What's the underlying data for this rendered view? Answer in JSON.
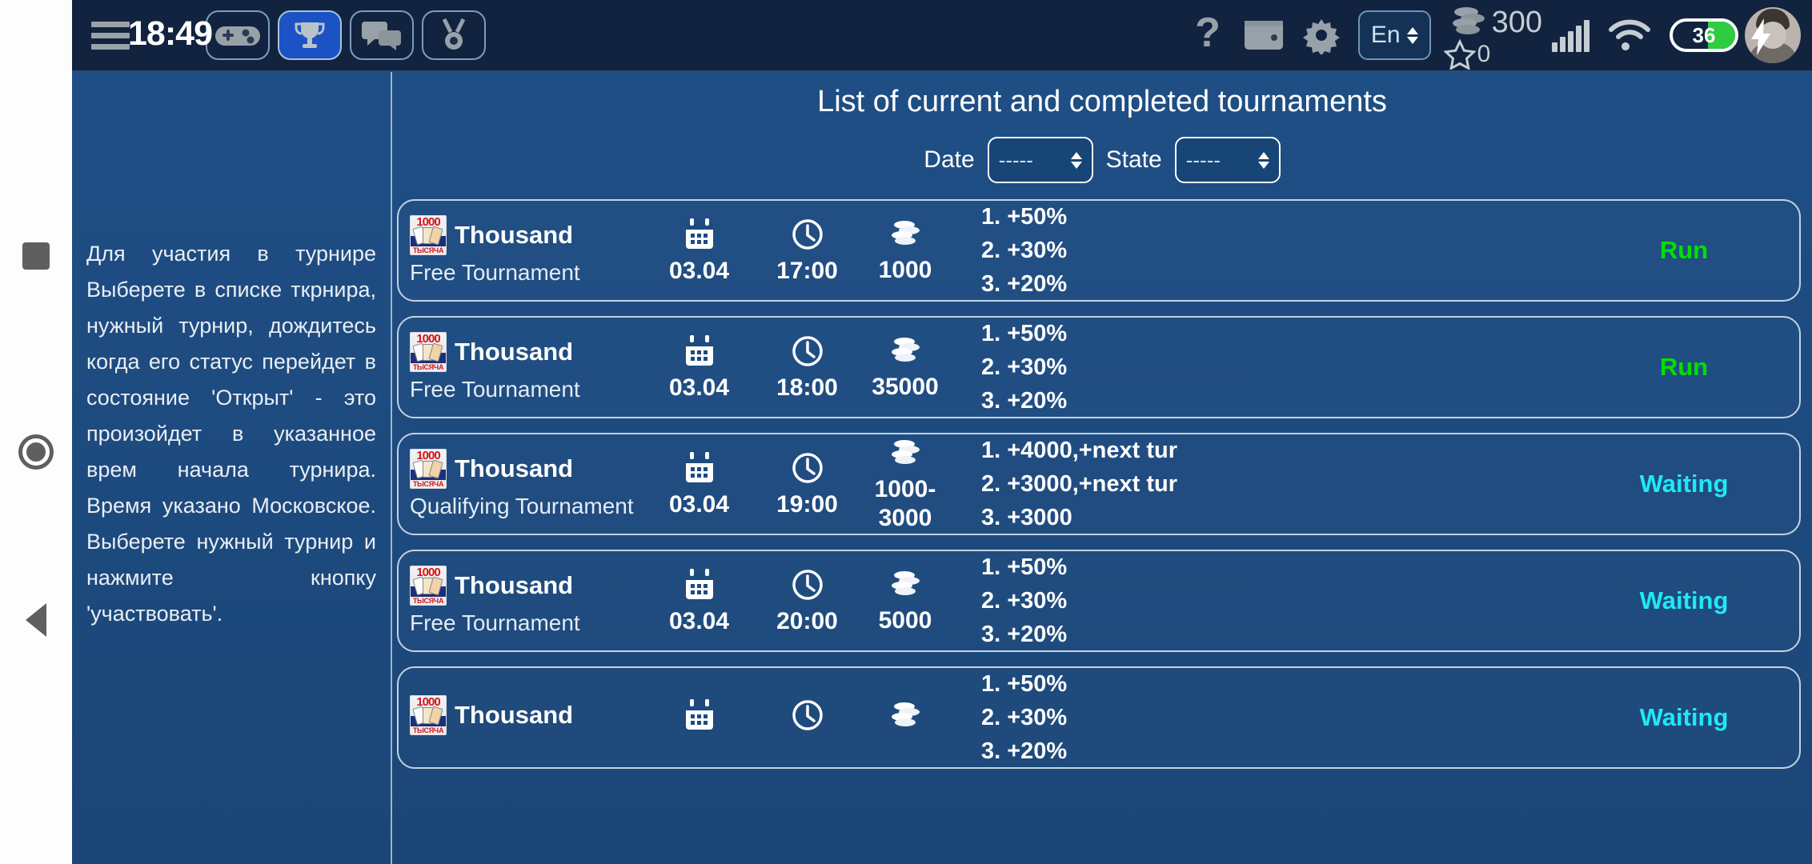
{
  "nav_rail": {
    "recent_label": "recent-apps",
    "home_label": "home",
    "back_label": "back"
  },
  "topbar": {
    "time": "18:49",
    "tabs": [
      {
        "icon": "gamepad-icon",
        "label": "",
        "active": false
      },
      {
        "icon": "trophy-icon",
        "label": "",
        "active": true
      },
      {
        "icon": "chat-icon",
        "label": "",
        "active": false
      },
      {
        "icon": "medal-icon",
        "label": "",
        "active": false
      }
    ],
    "help_icon": "question-mark-icon",
    "wallet_icon": "wallet-icon",
    "settings_icon": "gear-icon",
    "language": "En",
    "coins": "300",
    "stars": "0",
    "signal_icon": "signal-bars-icon",
    "wifi_icon": "wifi-icon",
    "battery": "36",
    "battery_charging_icon": "lightning-bolt-icon",
    "avatar_label": "user-avatar"
  },
  "left_panel": {
    "help_text": "Для участия в турнире Выберете в списке ткрнира, нужный турнир, дождитесь когда его статус перейдет в состояние 'Открыт' - это произойдет в указанное врем начала турнира. Время указано Московское. Выберете нужный турнир и нажмите кнопку 'участвовать'."
  },
  "main": {
    "title": "List of current and completed tournaments",
    "filters": {
      "date_label": "Date",
      "date_value": "-----",
      "state_label": "State",
      "state_value": "-----"
    },
    "tournaments": [
      {
        "game": "Thousand",
        "type": "Free Tournament",
        "date": "03.04",
        "time": "17:00",
        "buyin": "1000",
        "prizes": [
          "1. +50%",
          "2. +30%",
          "3. +20%"
        ],
        "status": "Run",
        "status_kind": "run"
      },
      {
        "game": "Thousand",
        "type": "Free Tournament",
        "date": "03.04",
        "time": "18:00",
        "buyin": "35000",
        "prizes": [
          "1. +50%",
          "2. +30%",
          "3. +20%"
        ],
        "status": "Run",
        "status_kind": "run"
      },
      {
        "game": "Thousand",
        "type": "Qualifying Tournament",
        "date": "03.04",
        "time": "19:00",
        "buyin": "1000-3000",
        "prizes": [
          "1. +4000,+next tur",
          "2. +3000,+next tur",
          "3. +3000"
        ],
        "status": "Waiting",
        "status_kind": "waiting"
      },
      {
        "game": "Thousand",
        "type": "Free Tournament",
        "date": "03.04",
        "time": "20:00",
        "buyin": "5000",
        "prizes": [
          "1. +50%",
          "2. +30%",
          "3. +20%"
        ],
        "status": "Waiting",
        "status_kind": "waiting"
      },
      {
        "game": "Thousand",
        "type": "",
        "date": "",
        "time": "",
        "buyin": "",
        "prizes": [
          "1. +50%",
          "2. +30%",
          "3. +20%"
        ],
        "status": "Waiting",
        "status_kind": "waiting"
      }
    ],
    "colors": {
      "run": "#00e000",
      "waiting": "#20e8f5",
      "panel_bg": "#1d4b80",
      "topbar_bg": "#12233f",
      "accent_blue": "#1b53c4"
    }
  }
}
